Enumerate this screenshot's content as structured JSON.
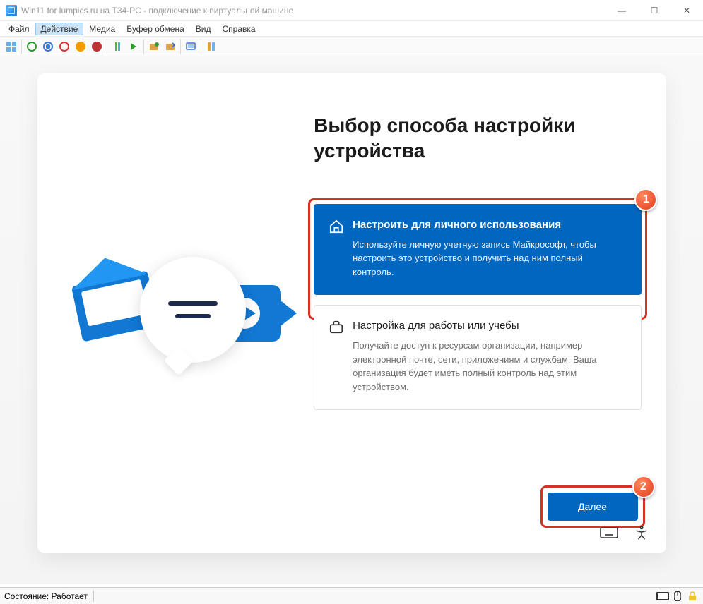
{
  "window": {
    "title": "Win11 for lumpics.ru на T34-PC - подключение к виртуальной машине"
  },
  "menu": {
    "file": "Файл",
    "action": "Действие",
    "media": "Медиа",
    "clipboard": "Буфер обмена",
    "view": "Вид",
    "help": "Справка"
  },
  "oobe": {
    "heading": "Выбор способа настройки устройства",
    "personal": {
      "title": "Настроить для личного использования",
      "desc": "Используйте личную учетную запись Майкрософт, чтобы настроить это устройство и получить над ним полный контроль."
    },
    "work": {
      "title": "Настройка для работы или учебы",
      "desc": "Получайте доступ к ресурсам организации, например электронной почте, сети, приложениям и службам. Ваша организация будет иметь полный контроль над этим устройством."
    },
    "next": "Далее"
  },
  "status": {
    "label": "Состояние: Работает"
  },
  "annotations": {
    "one": "1",
    "two": "2"
  }
}
